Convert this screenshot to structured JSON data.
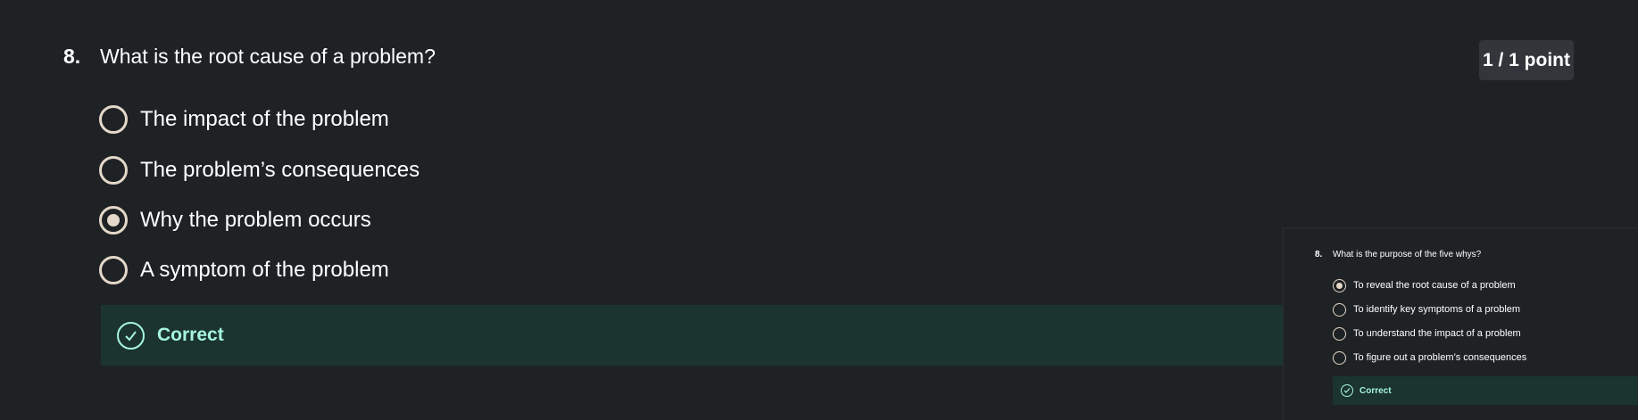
{
  "main": {
    "question_number": "8.",
    "question_text": "What is the root cause of a problem?",
    "points": "1 / 1 point",
    "options": [
      {
        "label": "The impact of the problem",
        "selected": false
      },
      {
        "label": "The problem’s consequences",
        "selected": false
      },
      {
        "label": "Why the problem occurs",
        "selected": true
      },
      {
        "label": "A symptom of the problem",
        "selected": false
      }
    ],
    "feedback": {
      "label": "Correct",
      "icon": "check-circle-icon"
    }
  },
  "inset": {
    "question_number": "8.",
    "question_text": "What is the purpose of the five whys?",
    "options": [
      {
        "label": "To reveal the root cause of a problem",
        "selected": true
      },
      {
        "label": "To identify key symptoms of a problem",
        "selected": false
      },
      {
        "label": "To understand the impact of a problem",
        "selected": false
      },
      {
        "label": "To figure out a problem’s consequences",
        "selected": false
      }
    ],
    "feedback": {
      "label": "Correct",
      "icon": "check-circle-icon"
    }
  },
  "colors": {
    "background": "#1f2224",
    "radio_border": "#e3d8c9",
    "feedback_bg": "#1b342d",
    "feedback_text": "#a6f5de",
    "badge_bg": "#32363a"
  }
}
